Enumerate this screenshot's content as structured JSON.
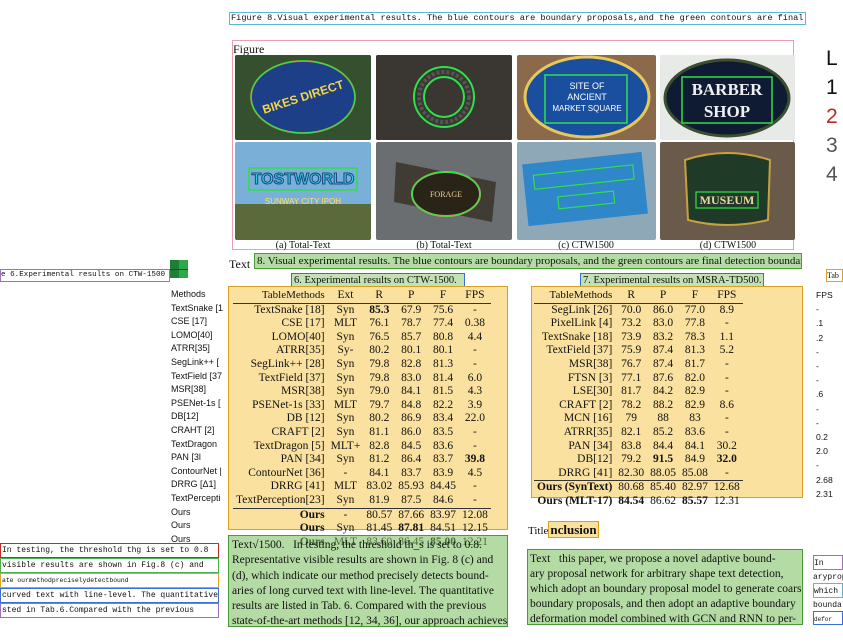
{
  "figure_caption_top": "Figure 8.Visual experimental results. The blue contours are boundary proposals,and the green contours are final detection boundaries.",
  "figure_label": "Figure",
  "photos": [
    {
      "text": "BIKES DIRECT",
      "caption": "(a) Total-Text"
    },
    {
      "text": "",
      "caption": "(b) Total-Text"
    },
    {
      "text": "SITE OF ANCIENT MARKET SQUARE",
      "caption": "(c) CTW1500"
    },
    {
      "text": "BARBER SHOP",
      "caption": "(d) CTW1500"
    },
    {
      "text": "TOSTWORLD",
      "caption": ""
    },
    {
      "text": "FORAGE",
      "caption": ""
    },
    {
      "text": "",
      "caption": ""
    },
    {
      "text": "MUSEUM",
      "caption": ""
    }
  ],
  "text_label": "Text",
  "figure_caption_main": "8.  Visual experimental results. The blue contours are boundary proposals, and the green contours are final detection boundaries.",
  "table6_caption": "6. Experimental results on CTW-1500.",
  "table7_caption": "7. Experimental results on MSRA-TD500.",
  "left_caption": "e 6.Experimental results on CTW-1500",
  "right_fragment": "Tab",
  "legend_fragment": {
    "head": "L",
    "items": [
      "1",
      "2",
      "3",
      "4"
    ]
  },
  "table6": {
    "label": "Table",
    "headers": [
      "Methods",
      "Ext",
      "R",
      "P",
      "F",
      "FPS"
    ],
    "rows": [
      [
        "TextSnake [18]",
        "Syn",
        "85.3",
        "67.9",
        "75.6",
        "-"
      ],
      [
        "CSE [17]",
        "MLT",
        "76.1",
        "78.7",
        "77.4",
        "0.38"
      ],
      [
        "LOMO[40]",
        "Syn",
        "76.5",
        "85.7",
        "80.8",
        "4.4"
      ],
      [
        "ATRR[35]",
        "Sy-",
        "80.2",
        "80.1",
        "80.1",
        "-"
      ],
      [
        "SegLink++ [28]",
        "Syn",
        "79.8",
        "82.8",
        "81.3",
        "-"
      ],
      [
        "TextField [37]",
        "Syn",
        "79.8",
        "83.0",
        "81.4",
        "6.0"
      ],
      [
        "MSR[38]",
        "Syn",
        "79.0",
        "84.1",
        "81.5",
        "4.3"
      ],
      [
        "PSENet-1s [33]",
        "MLT",
        "79.7",
        "84.8",
        "82.2",
        "3.9"
      ],
      [
        "DB [12]",
        "Syn",
        "80.2",
        "86.9",
        "83.4",
        "22.0"
      ],
      [
        "CRAFT [2]",
        "Syn",
        "81.1",
        "86.0",
        "83.5",
        "-"
      ],
      [
        "TextDragon [5]",
        "MLT+",
        "82.8",
        "84.5",
        "83.6",
        "-"
      ],
      [
        "PAN [34]",
        "Syn",
        "81.2",
        "86.4",
        "83.7",
        "39.8"
      ],
      [
        "ContourNet [36]",
        "-",
        "84.1",
        "83.7",
        "83.9",
        "4.5"
      ],
      [
        "DRRG [41]",
        "MLT",
        "83.02",
        "85.93",
        "84.45",
        "-"
      ],
      [
        "TextPerception[23]",
        "Syn",
        "81.9",
        "87.5",
        "84.6",
        "-"
      ],
      [
        "Ours",
        "-",
        "80.57",
        "87.66",
        "83.97",
        "12.08"
      ],
      [
        "Ours",
        "Syn",
        "81.45",
        "87.81",
        "84.51",
        "12.15"
      ],
      [
        "Ours",
        "MLT",
        "83.60",
        "86.45",
        "85.00",
        "12.21"
      ]
    ]
  },
  "table7": {
    "label": "Table",
    "headers": [
      "Methods",
      "R",
      "P",
      "F",
      "FPS"
    ],
    "rows": [
      [
        "SegLink [26]",
        "70.0",
        "86.0",
        "77.0",
        "8.9"
      ],
      [
        "PixelLink [4]",
        "73.2",
        "83.0",
        "77.8",
        "-"
      ],
      [
        "TextSnake [18]",
        "73.9",
        "83.2",
        "78.3",
        "1.1"
      ],
      [
        "TextField [37]",
        "75.9",
        "87.4",
        "81.3",
        "5.2"
      ],
      [
        "MSR[38]",
        "76.7",
        "87.4",
        "81.7",
        "-"
      ],
      [
        "FTSN [3]",
        "77.1",
        "87.6",
        "82.0",
        "-"
      ],
      [
        "LSE[30]",
        "81.7",
        "84.2",
        "82.9",
        "-"
      ],
      [
        "CRAFT [2]",
        "78.2",
        "88.2",
        "82.9",
        "8.6"
      ],
      [
        "MCN [16]",
        "79",
        "88",
        "83",
        "-"
      ],
      [
        "ATRR[35]",
        "82.1",
        "85.2",
        "83.6",
        "-"
      ],
      [
        "PAN [34]",
        "83.8",
        "84.4",
        "84.1",
        "30.2"
      ],
      [
        "DB[12]",
        "79.2",
        "91.5",
        "84.9",
        "32.0"
      ],
      [
        "DRRG [41]",
        "82.30",
        "88.05",
        "85.08",
        "-"
      ],
      [
        "Ours (SynText)",
        "80.68",
        "85.40",
        "82.97",
        "12.68"
      ],
      [
        "Ours (MLT-17)",
        "84.54",
        "86.62",
        "85.57",
        "12.31"
      ]
    ]
  },
  "left_methods": [
    "Methods",
    "TextSnake [1",
    "CSE [17]",
    "LOMO[40]",
    "ATRR[35]",
    "SegLink++ [",
    "TextField [37",
    "MSR[38]",
    "PSENet-1s [",
    "DB[12]",
    "CRAHT [2]",
    "TextDragon",
    "PAN [3l",
    "ContourNet |",
    "DRRG [Δ1]",
    "TextPercepti",
    "Ours",
    "Ours",
    "Ours"
  ],
  "right_fps": [
    "FPS",
    "-",
    ".1",
    ".2",
    "-",
    "-",
    "-",
    ".6",
    "-",
    "-",
    "0.2",
    "2.0",
    "-",
    "2.68",
    "2.31"
  ],
  "para_left_label": "Text",
  "para_left_head": "√1500.",
  "para_left_lines": [
    "In testing, the threshold th_s is set to 0.8.",
    "Representative visible results are shown in Fig. 8 (c) and",
    "(d), which indicate our method precisely detects bound-",
    "aries of long curved text with line-level. The quantitative",
    "results are listed in Tab. 6. Compared with the previous",
    "state-of-the-art methods [12, 34, 36], our approach achieves"
  ],
  "para_right_title_label": "Title",
  "para_right_title": "nclusion",
  "para_right_label": "Text",
  "para_right_lines": [
    "this paper, we propose a novel adaptive bound-",
    "ary proposal network for arbitrary shape text detection,",
    "which adopt an boundary proposal model to generate coarse",
    "boundary proposals, and then adopt an adaptive boundary",
    "deformation model combined with GCN and RNN to per-"
  ],
  "left_ocr_lines": [
    "In testing, the threshold thg is set to 0.8",
    "visible results are shown in Fig.8 (c) and",
    "ate ourmethodpreciselydetectbound",
    "curved text with line-level. The quantitative",
    "sted in Tab.6.Compared with the previous"
  ],
  "right_ocr_lines": [
    "In",
    "arypropo",
    "which",
    "bounda",
    "defor"
  ]
}
